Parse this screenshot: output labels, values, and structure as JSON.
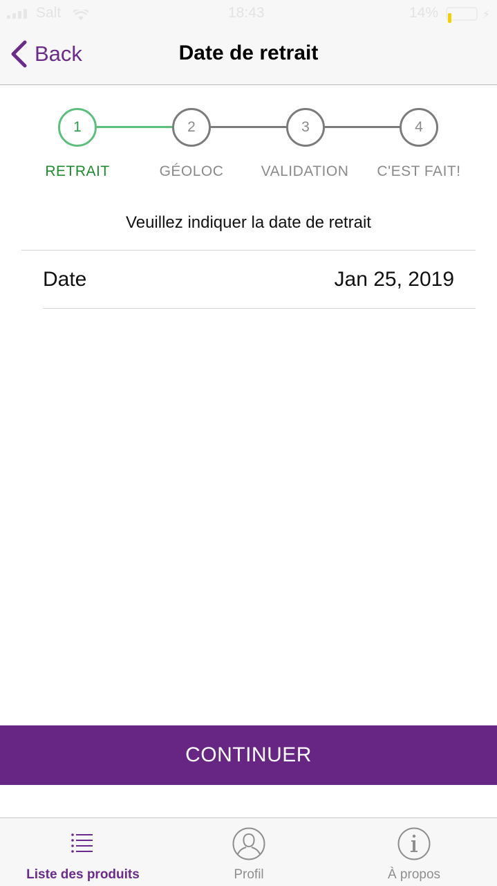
{
  "status_bar": {
    "carrier": "Salt",
    "time": "18:43",
    "battery_percent_label": "14%",
    "battery_level": 0.14,
    "battery_color": "#f5d000"
  },
  "nav": {
    "back_label": "Back",
    "title": "Date de retrait",
    "accent_color": "#6a2b8a"
  },
  "stepper": {
    "current_step": 1,
    "steps": [
      {
        "number": "1",
        "label": "RETRAIT"
      },
      {
        "number": "2",
        "label": "GÉOLOC"
      },
      {
        "number": "3",
        "label": "VALIDATION"
      },
      {
        "number": "4",
        "label": "C'EST FAIT!"
      }
    ],
    "active_color": "#5cbf7c",
    "inactive_color": "#7b7b7b"
  },
  "form": {
    "instruction": "Veuillez indiquer la date de retrait",
    "date_label": "Date",
    "date_value": "Jan 25, 2019"
  },
  "continue_button": {
    "label": "CONTINUER",
    "color": "#672584"
  },
  "tab_bar": {
    "active_index": 0,
    "tabs": [
      {
        "label": "Liste des produits",
        "icon": "list-icon"
      },
      {
        "label": "Profil",
        "icon": "person-icon"
      },
      {
        "label": "À propos",
        "icon": "info-icon"
      }
    ]
  }
}
